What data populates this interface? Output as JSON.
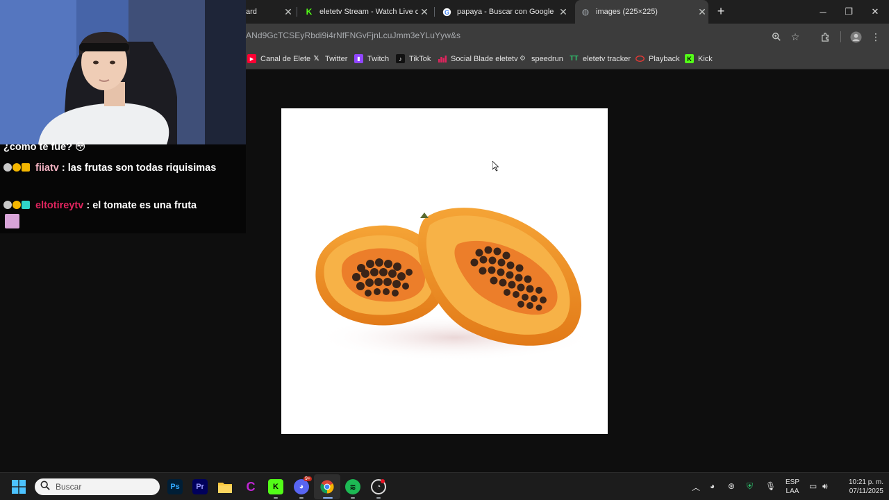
{
  "tabs": [
    {
      "title": "ard",
      "icon": "dashboard-tab-icon"
    },
    {
      "title": "eletetv Stream - Watch Live on",
      "icon": "kick-icon"
    },
    {
      "title": "papaya - Buscar con Google",
      "icon": "google-icon"
    },
    {
      "title": "images (225×225)",
      "icon": "globe-icon",
      "active": true
    }
  ],
  "address_bar": {
    "url": "ANd9GcTCSEyRbdi9i4rNfFNGvFjnLcuJmm3eYLuYyw&s"
  },
  "bookmarks": [
    {
      "label": "Canal de Elete",
      "icon": "youtube-icon",
      "color": "#ff0033"
    },
    {
      "label": "Twitter",
      "icon": "x-icon",
      "color": "#ffffff"
    },
    {
      "label": "Twitch",
      "icon": "twitch-icon",
      "color": "#9146ff"
    },
    {
      "label": "TikTok",
      "icon": "tiktok-icon",
      "color": "#ffffff"
    },
    {
      "label": "Social Blade eletetv",
      "icon": "socialblade-icon",
      "color": "#e0245e"
    },
    {
      "label": "speedrun",
      "icon": "speedrun-icon",
      "color": "#c4c7c5"
    },
    {
      "label": "eletetv tracker",
      "icon": "tracker-icon",
      "color": "#2ecc71"
    },
    {
      "label": "Playback",
      "icon": "playback-icon",
      "color": "#e53935"
    },
    {
      "label": "Kick",
      "icon": "kick-icon",
      "color": "#53fc18"
    }
  ],
  "chat": {
    "messages": [
      {
        "user": "",
        "text": "¿como te fue? 😳"
      },
      {
        "user": "fiiatv",
        "separator": ":",
        "text": "las frutas son todas riquisimas"
      },
      {
        "user": "eltotireytv",
        "separator": ":",
        "text": "el tomate es una fruta"
      }
    ]
  },
  "taskbar": {
    "search_placeholder": "Buscar",
    "apps": [
      "windows-start-icon",
      "photoshop-icon",
      "premiere-icon",
      "file-explorer-icon",
      "canva-icon",
      "kick-icon",
      "discord-icon",
      "chrome-icon",
      "spotify-icon",
      "obs-icon"
    ],
    "discord_badge": "9+",
    "language": "ESP",
    "layout": "LAA",
    "time": "10:21 p. m.",
    "date": "07/11/2025"
  },
  "colors": {
    "tabbar_bg": "#1f1f1f",
    "toolbar_bg": "#3c3c3c",
    "taskbar_bg": "#1c1c1c",
    "papaya_orange": "#f29a2e",
    "papaya_flesh": "#f7b247"
  }
}
